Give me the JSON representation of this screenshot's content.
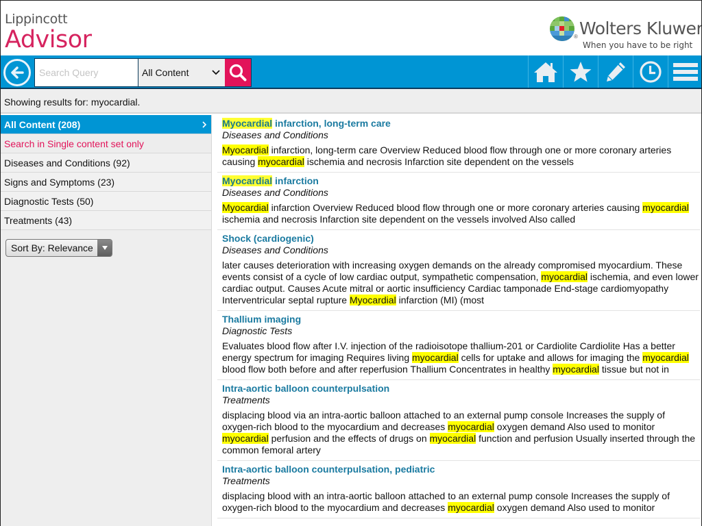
{
  "header": {
    "brand_top": "Lippincott",
    "brand_main": "Advisor",
    "publisher": "Wolters Kluwer",
    "tagline": "When you have to be right"
  },
  "toolbar": {
    "search_placeholder": "Search Query",
    "search_value": "",
    "scope_selected": "All Content",
    "icons": [
      "back-icon",
      "search-icon",
      "home-icon",
      "favorites-star-icon",
      "notes-pencil-icon",
      "history-clock-icon",
      "menu-icon"
    ]
  },
  "status": {
    "text": "Showing results for: myocardial."
  },
  "sidebar": {
    "items": [
      {
        "label": "All Content (208)",
        "active": true
      },
      {
        "label": "Search in Single content set only"
      },
      {
        "label": "Diseases and Conditions (92)"
      },
      {
        "label": "Signs and Symptoms (23)"
      },
      {
        "label": "Diagnostic Tests (50)"
      },
      {
        "label": "Treatments (43)"
      }
    ],
    "sort_label": "Sort By: Relevance"
  },
  "highlight_color": "#ffff00",
  "accent_color": "#0095d4",
  "results": [
    {
      "title": [
        {
          "t": "Myocardial",
          "h": true
        },
        {
          "t": " infarction, long-term care"
        }
      ],
      "category": "Diseases and Conditions",
      "snippet": [
        {
          "t": "Myocardial",
          "h": true
        },
        {
          "t": " infarction, long-term care Overview Reduced blood flow through one or more coronary arteries causing "
        },
        {
          "t": "myocardial",
          "h": true
        },
        {
          "t": " ischemia and necrosis Infarction site dependent on the vessels"
        }
      ]
    },
    {
      "title": [
        {
          "t": "Myocardial",
          "h": true
        },
        {
          "t": " infarction"
        }
      ],
      "category": "Diseases and Conditions",
      "snippet": [
        {
          "t": "Myocardial",
          "h": true
        },
        {
          "t": " infarction Overview Reduced blood flow through one or more coronary arteries causing "
        },
        {
          "t": "myocardial",
          "h": true
        },
        {
          "t": " ischemia and necrosis Infarction site dependent on the vessels involved Also called"
        }
      ]
    },
    {
      "title": [
        {
          "t": "Shock (cardiogenic)"
        }
      ],
      "category": "Diseases and Conditions",
      "snippet": [
        {
          "t": "later causes deterioration with increasing oxygen demands on the already compromised myocardium. These events consist of a cycle of low cardiac output, sympathetic compensation, "
        },
        {
          "t": "myocardial",
          "h": true
        },
        {
          "t": " ischemia, and even lower cardiac output. Causes Acute mitral or aortic insufficiency Cardiac tamponade End-stage cardiomyopathy Interventricular septal rupture "
        },
        {
          "t": "Myocardial",
          "h": true
        },
        {
          "t": " infarction (MI) (most"
        }
      ]
    },
    {
      "title": [
        {
          "t": "Thallium imaging"
        }
      ],
      "category": "Diagnostic Tests",
      "snippet": [
        {
          "t": "Evaluates blood flow after I.V. injection of the radioisotope thallium-201 or Cardiolite Cardiolite Has a better energy spectrum for imaging Requires living "
        },
        {
          "t": "myocardial",
          "h": true
        },
        {
          "t": " cells for uptake and allows for imaging the "
        },
        {
          "t": "myocardial",
          "h": true
        },
        {
          "t": " blood flow both before and after reperfusion Thallium Concentrates in healthy "
        },
        {
          "t": "myocardial",
          "h": true
        },
        {
          "t": " tissue but not in"
        }
      ]
    },
    {
      "title": [
        {
          "t": "Intra-aortic balloon counterpulsation"
        }
      ],
      "category": "Treatments",
      "snippet": [
        {
          "t": "displacing blood via an intra-aortic balloon attached to an external pump console Increases the supply of oxygen-rich blood to the myocardium and decreases "
        },
        {
          "t": "myocardial",
          "h": true
        },
        {
          "t": " oxygen demand Also used to monitor "
        },
        {
          "t": "myocardial",
          "h": true
        },
        {
          "t": " perfusion and the effects of drugs on "
        },
        {
          "t": "myocardial",
          "h": true
        },
        {
          "t": " function and perfusion Usually inserted through the common femoral artery"
        }
      ]
    },
    {
      "title": [
        {
          "t": "Intra-aortic balloon counterpulsation, pediatric"
        }
      ],
      "category": "Treatments",
      "snippet": [
        {
          "t": "displacing blood with an intra-aortic balloon attached to an external pump console Increases the supply of oxygen-rich blood to the myocardium and decreases "
        },
        {
          "t": "myocardial",
          "h": true
        },
        {
          "t": " oxygen demand Also used to monitor"
        }
      ]
    }
  ]
}
